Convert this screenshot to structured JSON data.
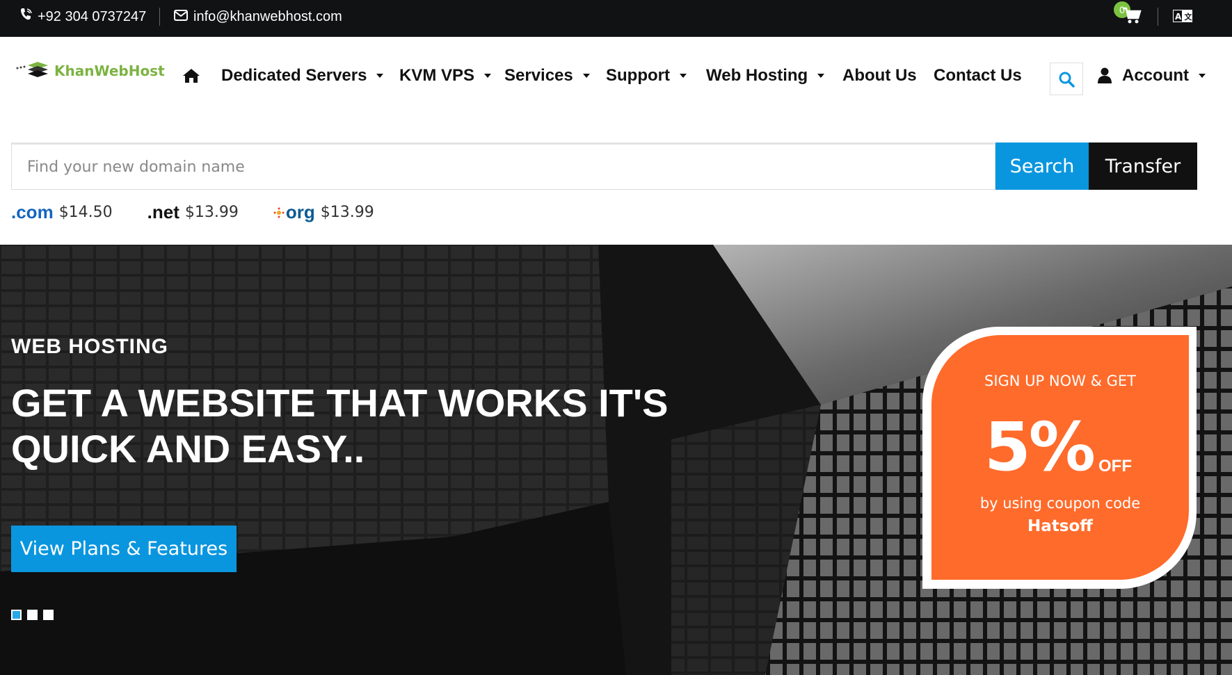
{
  "topbar": {
    "phone": "+92 304 0737247",
    "email": "info@khanwebhost.com",
    "cart_count": "0"
  },
  "brand": {
    "name": "KhanWebHost"
  },
  "nav": {
    "items": [
      {
        "label": "Dedicated Servers",
        "has_dropdown": true
      },
      {
        "label": "KVM VPS",
        "has_dropdown": true
      },
      {
        "label": "Services",
        "has_dropdown": true
      },
      {
        "label": "Support",
        "has_dropdown": true
      },
      {
        "label": "Web Hosting",
        "has_dropdown": true
      },
      {
        "label": "About Us",
        "has_dropdown": false
      },
      {
        "label": "Contact Us",
        "has_dropdown": false
      }
    ],
    "account_label": "Account"
  },
  "domain_search": {
    "placeholder": "Find your new domain name",
    "value": "",
    "search_label": "Search",
    "transfer_label": "Transfer",
    "tlds": [
      {
        "ext": ".com",
        "price": "$14.50"
      },
      {
        "ext": ".net",
        "price": "$13.99"
      },
      {
        "ext": "org",
        "price": "$13.99"
      }
    ]
  },
  "hero": {
    "subtitle": "WEB HOSTING",
    "title_line1": "GET A WEBSITE THAT WORKS IT'S",
    "title_line2": "QUICK AND EASY..",
    "cta_label": "View Plans & Features",
    "slides": 3,
    "active_slide": 1
  },
  "promo": {
    "heading": "SIGN UP NOW & GET",
    "percent": "5%",
    "off": "OFF",
    "text": "by using coupon code",
    "code": "Hatsoff"
  },
  "colors": {
    "accent_blue": "#0a96df",
    "promo_orange": "#ff6b2b",
    "brand_green": "#7cb342",
    "topbar_bg": "#111214"
  }
}
